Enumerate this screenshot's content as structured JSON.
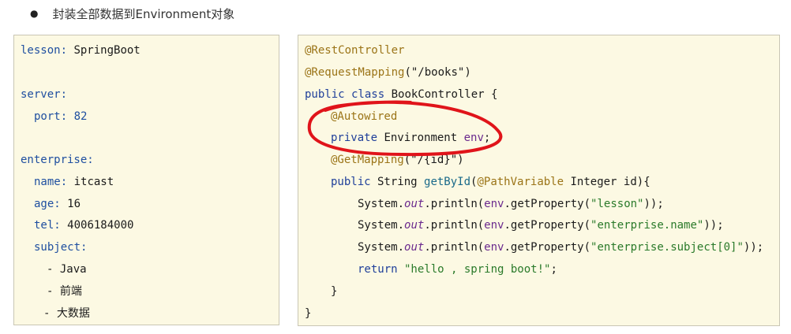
{
  "heading": {
    "bullet": "●",
    "text": "封装全部数据到Environment对象"
  },
  "yaml": {
    "lesson_key": "lesson:",
    "lesson_val": "SpringBoot",
    "server_key": "server:",
    "port_key": "port:",
    "port_val": "82",
    "enterprise_key": "enterprise:",
    "name_key": "name:",
    "name_val": "itcast",
    "age_key": "age:",
    "age_val": "16",
    "tel_key": "tel:",
    "tel_val": "4006184000",
    "subject_key": "subject:",
    "subjects": [
      "- Java",
      "- 前端",
      "- 大数据"
    ]
  },
  "code": {
    "l1_ann": "@RestController",
    "l2_ann": "@RequestMapping",
    "l2_open": "(",
    "l2_str": "\"/books\"",
    "l2_close": ")",
    "l3_kw": "public class",
    "l3_rest": " BookController {",
    "l4_ann": "@Autowired",
    "l5_kw": "private",
    "l5_type": " Environment ",
    "l5_var": "env",
    "l5_end": ";",
    "l6_ann": "@GetMapping",
    "l6_open": "(",
    "l6_str": "\"/{id}\"",
    "l6_close": ")",
    "l7_kw": "public",
    "l7_type": " String ",
    "l7_method": "getById",
    "l7_open": "(",
    "l7_ann": "@PathVariable",
    "l7_rest": " Integer id){",
    "print_prefix": "System.",
    "print_out": "out",
    "print_call": ".println(",
    "print_env": "env",
    "print_get": ".getProperty(",
    "l8_str": "\"lesson\"",
    "l9_str": "\"enterprise.name\"",
    "l10_str": "\"enterprise.subject[0]\"",
    "print_end": "));",
    "l11_kw": "return",
    "l11_str": " \"hello , spring boot!\"",
    "l11_end": ";",
    "l12": "}",
    "l13": "}"
  },
  "colors": {
    "panel_bg": "#fcf9e3",
    "panel_border": "#c9c6b4",
    "circle": "#e0141a"
  }
}
